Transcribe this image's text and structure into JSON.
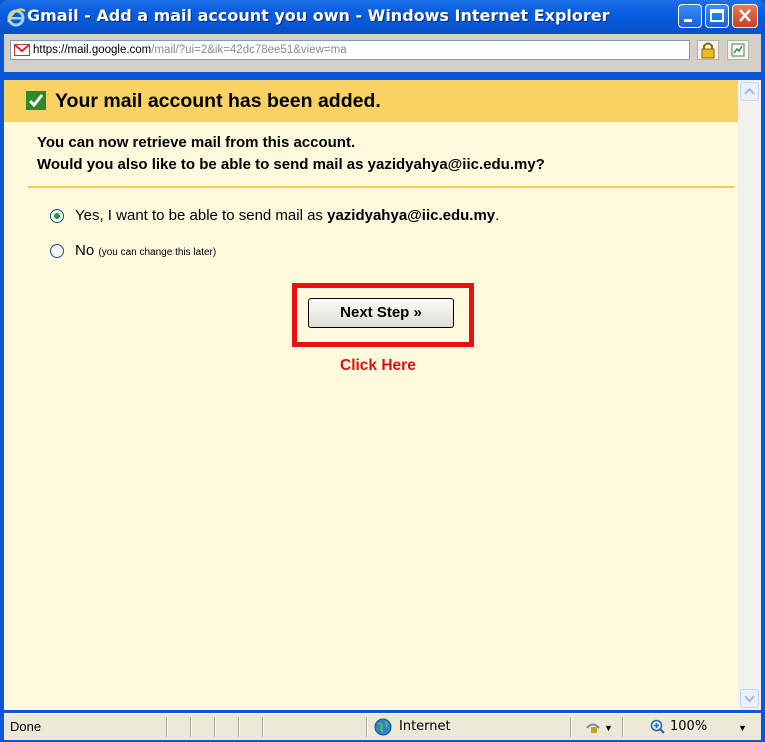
{
  "window": {
    "title": "Gmail - Add a mail account you own - Windows Internet Explorer"
  },
  "address_bar": {
    "url_prefix": "https://mail.",
    "url_domain": "google.com",
    "url_rest": "/mail/?ui=2&ik=42dc78ee51&view=ma",
    "lock_icon": "padlock-icon",
    "rss_icon": "feed-icon"
  },
  "page": {
    "success_title": "Your mail account has been added.",
    "line1": "You can now retrieve mail from this account.",
    "line2": "Would you also like to be able to send mail as yazidyahya@iic.edu.my?",
    "option_yes_prefix": "Yes, I want to be able to send mail as ",
    "option_yes_email": "yazidyahya@iic.edu.my",
    "option_yes_suffix": ".",
    "option_no_label": "No",
    "option_no_hint": "(you can change this later)",
    "selected_option": "yes",
    "next_button": "Next Step »",
    "click_here": "Click Here"
  },
  "status_bar": {
    "status": "Done",
    "zone": "Internet",
    "zoom": "100%"
  },
  "colors": {
    "header_bg": "#fad163",
    "content_bg": "#fff9dd",
    "highlight": "#e81010",
    "titlebar": "#0757d6"
  }
}
